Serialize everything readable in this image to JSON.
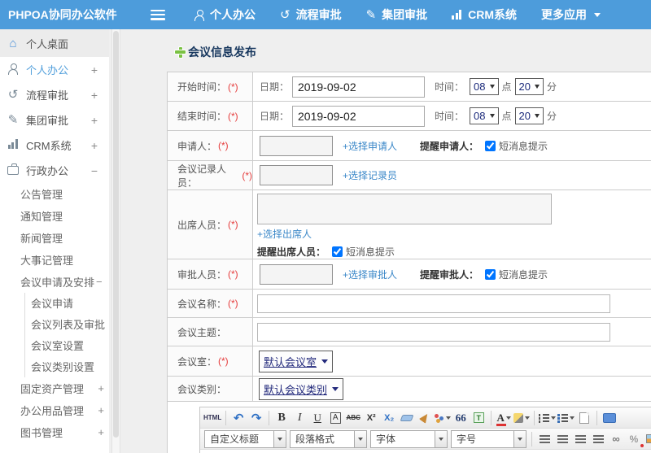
{
  "header": {
    "brand": "PHPOA协同办公软件",
    "menu": [
      {
        "label": "个人办公"
      },
      {
        "label": "流程审批"
      },
      {
        "label": "集团审批"
      },
      {
        "label": "CRM系统"
      },
      {
        "label": "更多应用"
      }
    ]
  },
  "sidebar": {
    "items": [
      {
        "label": "个人桌面",
        "expand": ""
      },
      {
        "label": "个人办公",
        "expand": "+"
      },
      {
        "label": "流程审批",
        "expand": "+"
      },
      {
        "label": "集团审批",
        "expand": "+"
      },
      {
        "label": "CRM系统",
        "expand": "+"
      },
      {
        "label": "行政办公",
        "expand": "−"
      }
    ],
    "admin_subitems": [
      {
        "label": "公告管理"
      },
      {
        "label": "通知管理"
      },
      {
        "label": "新闻管理"
      },
      {
        "label": "大事记管理"
      },
      {
        "label": "会议申请及安排",
        "expand": "−"
      }
    ],
    "meeting_subitems": [
      {
        "label": "会议申请"
      },
      {
        "label": "会议列表及审批"
      },
      {
        "label": "会议室设置"
      },
      {
        "label": "会议类别设置"
      }
    ],
    "bottom_subitems": [
      {
        "label": "固定资产管理",
        "expand": "+"
      },
      {
        "label": "办公用品管理",
        "expand": "+"
      },
      {
        "label": "图书管理",
        "expand": "+"
      }
    ]
  },
  "main": {
    "title": "会议信息发布",
    "form": {
      "required_mark": "(*)",
      "start_time": {
        "label": "开始时间：",
        "date_label": "日期：",
        "date": "2019-09-02",
        "time_label": "时间：",
        "hour": "08",
        "hour_unit": "点",
        "minute": "20",
        "minute_unit": "分"
      },
      "end_time": {
        "label": "结束时间：",
        "date_label": "日期：",
        "date": "2019-09-02",
        "time_label": "时间：",
        "hour": "08",
        "hour_unit": "点",
        "minute": "20",
        "minute_unit": "分"
      },
      "applicant": {
        "label": "申请人：",
        "link": "+选择申请人",
        "remind": "提醒申请人：",
        "sms": "短消息提示"
      },
      "recorder": {
        "label": "会议记录人员：",
        "link": "+选择记录员"
      },
      "attendees": {
        "label": "出席人员：",
        "link": "+选择出席人",
        "remind": "提醒出席人员：",
        "sms": "短消息提示"
      },
      "approver": {
        "label": "审批人员：",
        "link": "+选择审批人",
        "remind": "提醒审批人：",
        "sms": "短消息提示"
      },
      "meeting_name": {
        "label": "会议名称："
      },
      "meeting_subject": {
        "label": "会议主题："
      },
      "meeting_room": {
        "label": "会议室：",
        "value": "默认会议室"
      },
      "meeting_category": {
        "label": "会议类别：",
        "value": "默认会议类别"
      }
    }
  },
  "editor": {
    "buttons": {
      "html": "HTML",
      "undo": "↶",
      "redo": "↷",
      "bold": "B",
      "italic": "I",
      "underline": "U",
      "boxed_a": "A",
      "strike": "ABC",
      "sup": "X²",
      "sub": "X₂",
      "quote": "66",
      "font_color": "A",
      "link": "∞",
      "anchor": "%"
    },
    "dropdowns": [
      {
        "label": "自定义标题"
      },
      {
        "label": "段落格式"
      },
      {
        "label": "字体"
      },
      {
        "label": "字号"
      }
    ]
  }
}
